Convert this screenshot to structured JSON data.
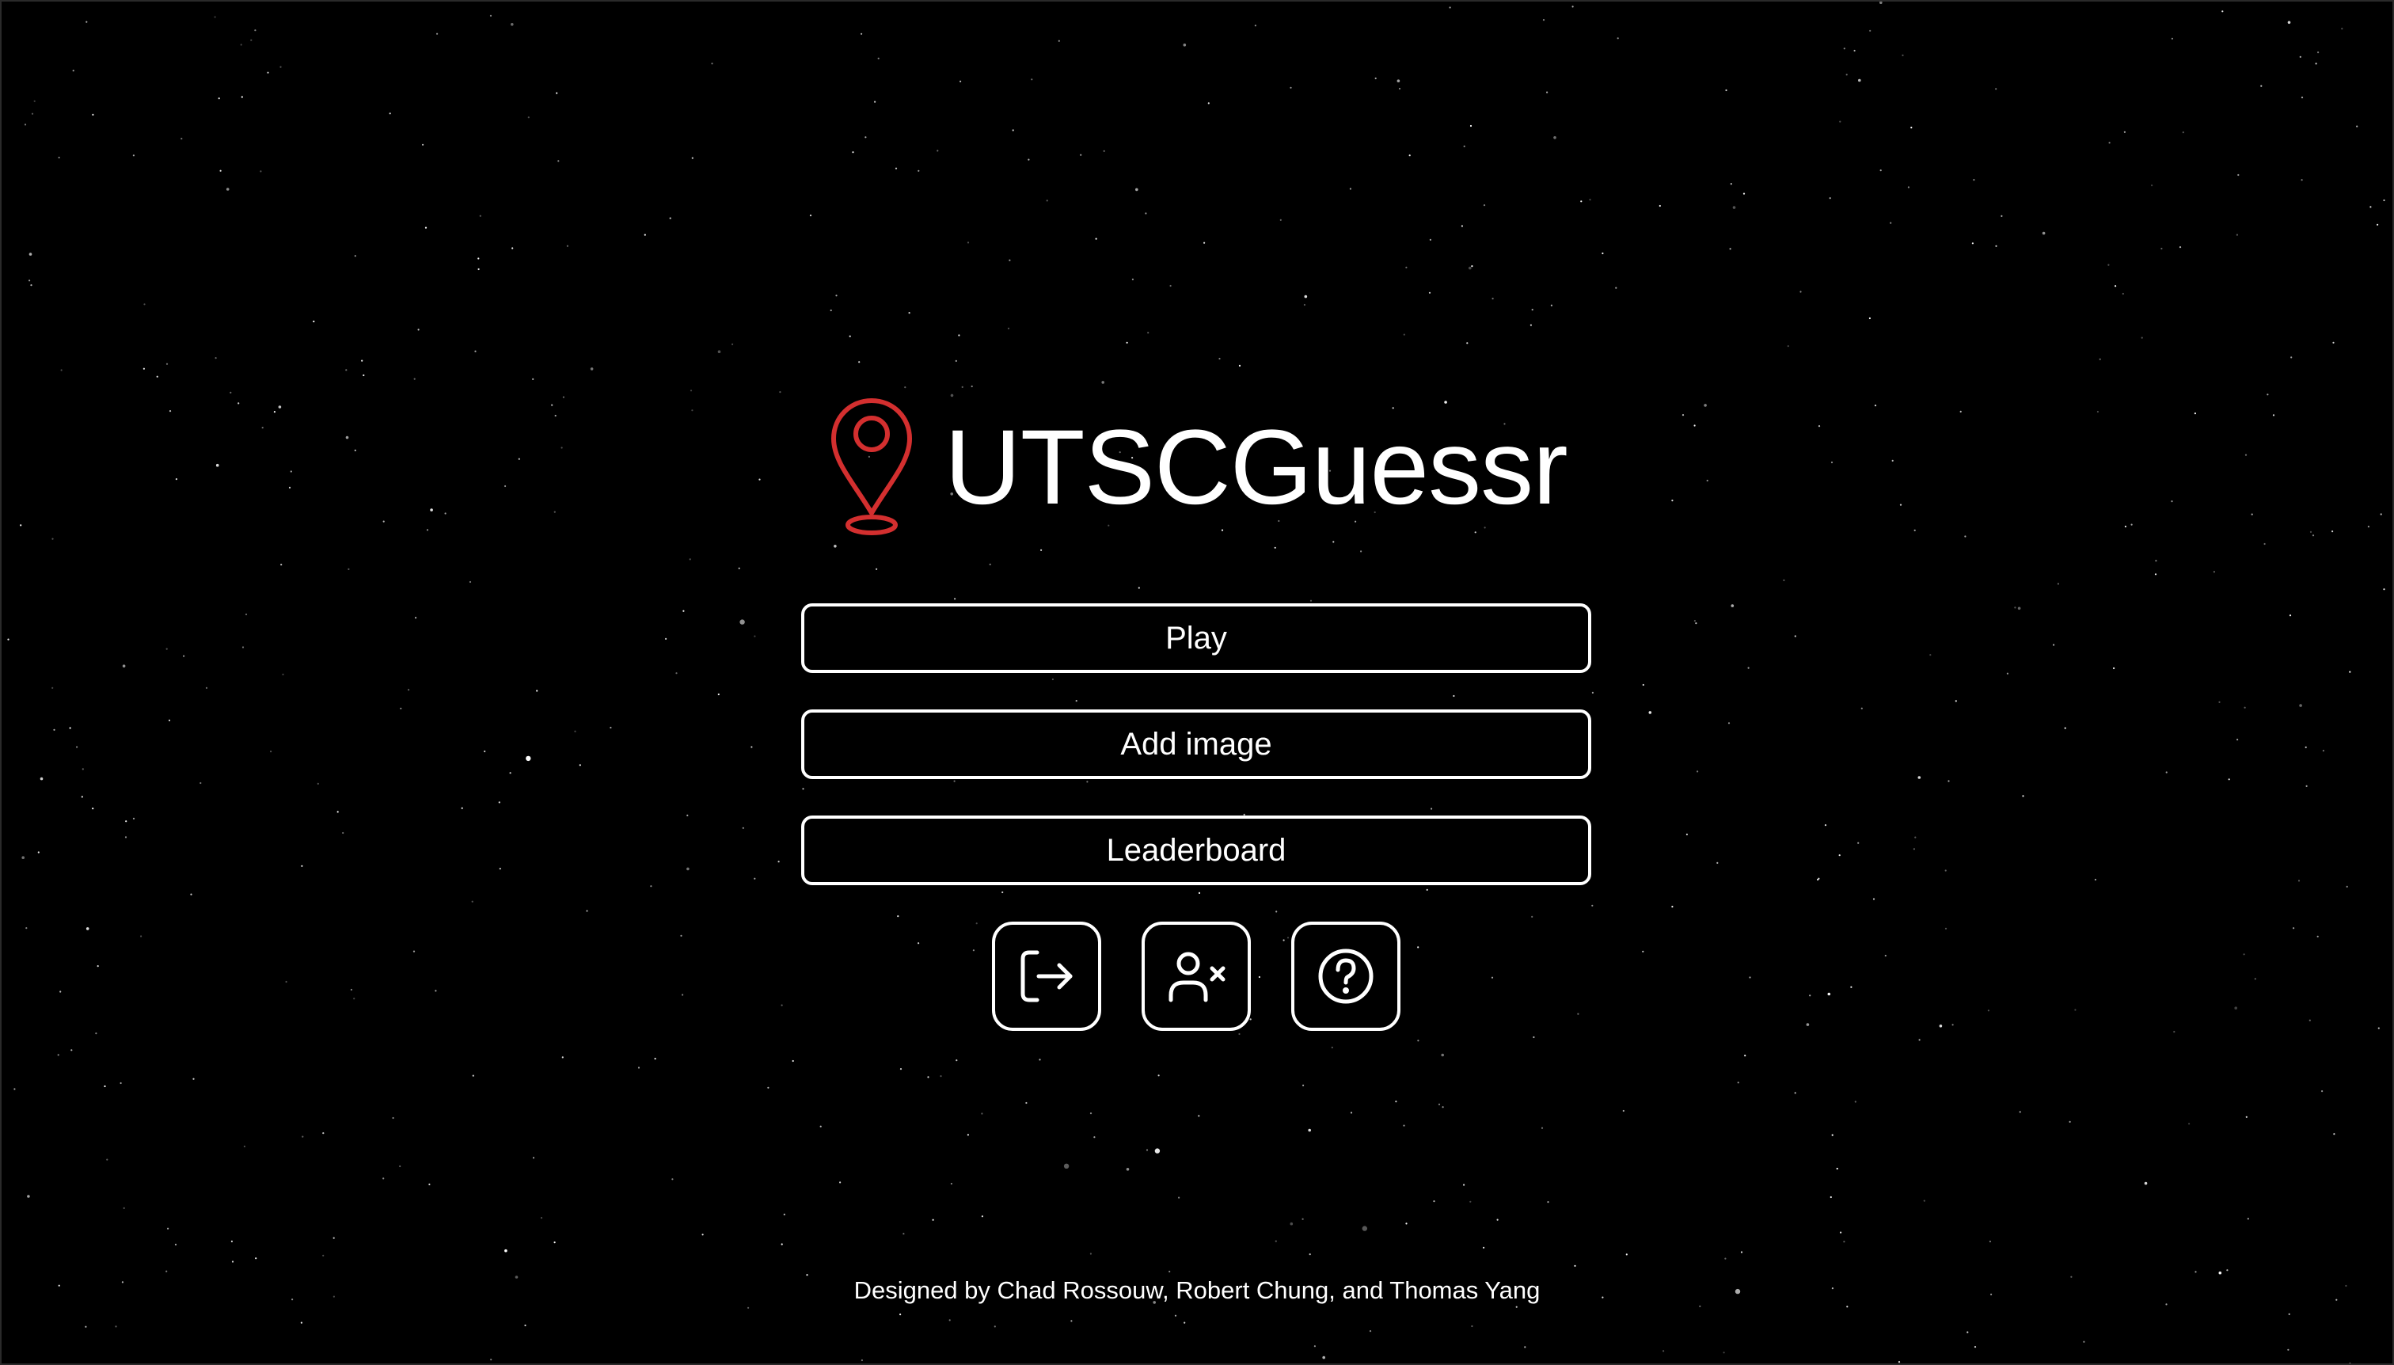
{
  "app": {
    "title": "UTSCGuessr",
    "logo_icon": "map-pin-icon",
    "accent_color": "#d32f2f"
  },
  "menu": {
    "play_label": "Play",
    "add_image_label": "Add image",
    "leaderboard_label": "Leaderboard"
  },
  "icon_buttons": [
    {
      "icon": "logout-icon"
    },
    {
      "icon": "delete-user-icon"
    },
    {
      "icon": "help-icon"
    }
  ],
  "footer": {
    "credits": "Designed by Chad Rossouw, Robert Chung, and Thomas Yang"
  }
}
